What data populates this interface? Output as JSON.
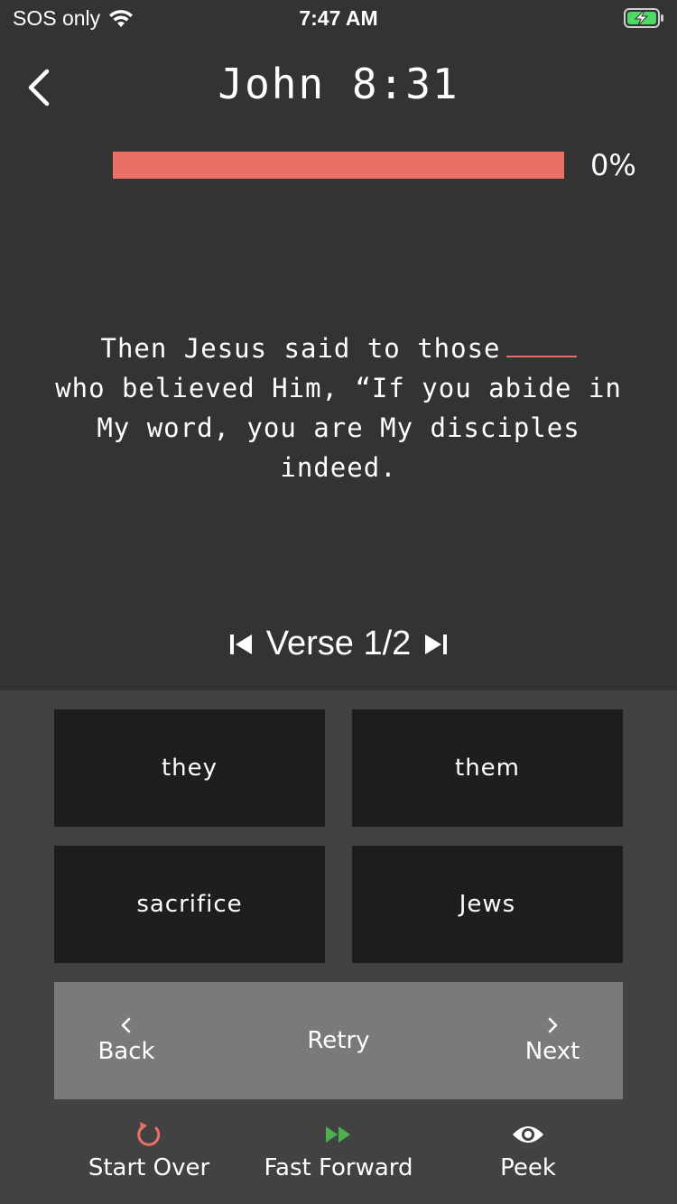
{
  "status": {
    "carrier": "SOS only",
    "time": "7:47 AM",
    "icons": [
      "wifi-icon",
      "battery-charging-icon"
    ],
    "battery_color": "#4cd964"
  },
  "header": {
    "title": "John 8:31",
    "back_icon": "chevron-left-icon"
  },
  "progress": {
    "value": 0,
    "label": "0%",
    "color": "#ea6f66"
  },
  "verse": {
    "text_before_blank": "Then Jesus said to those",
    "text_after_blank": "who believed Him, “If you abide in My word, you are My disciples indeed.",
    "blank_color": "#ea6f66"
  },
  "verse_nav": {
    "label": "Verse 1/2",
    "prev_icon": "skip-previous-icon",
    "next_icon": "skip-next-icon"
  },
  "choices": [
    "they",
    "them",
    "sacrifice",
    "Jews"
  ],
  "actions": {
    "back": "Back",
    "retry": "Retry",
    "next": "Next"
  },
  "toolbar": {
    "start_over": "Start Over",
    "fast_forward": "Fast Forward",
    "peek": "Peek",
    "start_over_color": "#ea6f66",
    "fast_forward_color": "#4caf50"
  }
}
